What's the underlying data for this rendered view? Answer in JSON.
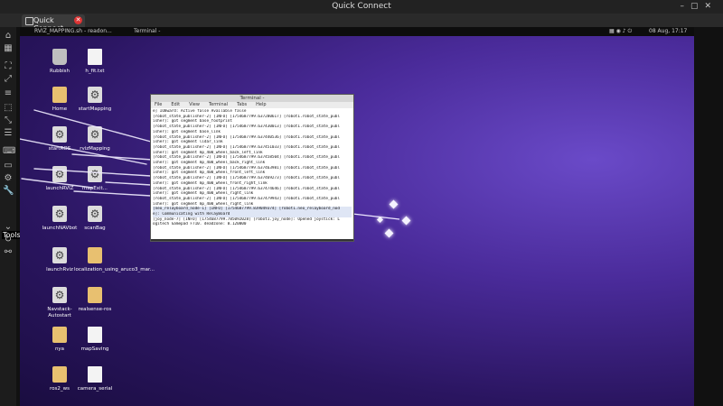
{
  "window": {
    "title": "Quick Connect"
  },
  "tabs": [
    {
      "label": "Quick Connect"
    }
  ],
  "left_toolbar": {
    "tools_label": "Tools",
    "icons": [
      "home-icon",
      "grid-icon",
      "fullscreen-icon",
      "expand-icon",
      "list-icon",
      "expand-icon",
      "select-icon",
      "menu-icon",
      "keyboard-icon",
      "mouse-icon",
      "settings-icon",
      "tools-icon",
      "chevron-down-icon",
      "refresh-icon",
      "link-icon"
    ]
  },
  "remote_topbar": {
    "apps": [
      "RVIZ_MAPPING.sh - readon...",
      "Terminal -"
    ],
    "datetime": "08 Aug, 17:17"
  },
  "desktop_icons": [
    {
      "label": "Rubbish",
      "type": "trash"
    },
    {
      "label": "h_fit.txt",
      "type": "file"
    },
    {
      "label": "Home",
      "type": "folder"
    },
    {
      "label": "startMapping",
      "type": "gear"
    },
    {
      "label": "startROS",
      "type": "gear"
    },
    {
      "label": "rvizMapping",
      "type": "gear"
    },
    {
      "label": "launchRVIZ",
      "type": "gear"
    },
    {
      "label": "mapExit...",
      "type": "gear"
    },
    {
      "label": "launchNAVbot",
      "type": "gear"
    },
    {
      "label": "scanBag",
      "type": "gear"
    },
    {
      "label": "launchRviz",
      "type": "gear"
    },
    {
      "label": "localization_using_aruco3_mar...",
      "type": "folder"
    },
    {
      "label": "Navstack-Autostart",
      "type": "gear"
    },
    {
      "label": "realsense-ros",
      "type": "folder"
    },
    {
      "label": "nya",
      "type": "folder"
    },
    {
      "label": "mapSaving",
      "type": "file"
    },
    {
      "label": "ros2_ws",
      "type": "folder"
    },
    {
      "label": "camera_serial",
      "type": "file"
    }
  ],
  "terminal": {
    "title": "Terminal -",
    "menu": [
      "File",
      "Edit",
      "View",
      "Terminal",
      "Tabs",
      "Help"
    ],
    "lines": [
      "e] IO8ward: Active false    Available false",
      "[robot_state_publisher-2] [INFO] [1754687799.637280617] [robot1.robot_state_publ",
      "isher]: got segment base_footprint",
      "[robot_state_publisher-2] [INFO] [1754687799.637430013] [robot1.robot_state_publ",
      "isher]: got segment base_link",
      "[robot_state_publisher-2] [INFO] [1754687799.637440536] [robot1.robot_state_publ",
      "isher]: got segment lidar_link",
      "[robot_state_publisher-2] [INFO] [1754687799.637451033] [robot1.robot_state_publ",
      "isher]: got segment mp_400_wheel_back_left_link",
      "[robot_state_publisher-2] [INFO] [1754687799.637458504] [robot1.robot_state_publ",
      "isher]: got segment mp_400_wheel_back_right_link",
      "[robot_state_publisher-2] [INFO] [1754687799.637463981] [robot1.robot_state_publ",
      "isher]: got segment mp_400_wheel_front_left_link",
      "[robot_state_publisher-2] [INFO] [1754687799.637469273] [robot1.robot_state_publ",
      "isher]: got segment mp_400_wheel_front_right_link",
      "[robot_state_publisher-2] [INFO] [1754687799.637474646] [robot1.robot_state_publ",
      "isher]: got segment mp_400_wheel_right_link",
      "[robot_state_publisher-2] [INFO] [1754687799.637479943] [robot1.robot_state_publ",
      "isher]: got segment mp_400_wheel_right_link",
      "[neo_relayboard_node-1] [INFO] [1754687799.839049374] [robot1.neo_relayboard_nod",
      "e]: Communicating with RelayBoard",
      "[joy_node-7] [INFO] [1754687799.785092028] [robot1.joy_node]: Opened joystick: L",
      "ogitech Gamepad F710.  deadzone: 0.120000"
    ]
  }
}
